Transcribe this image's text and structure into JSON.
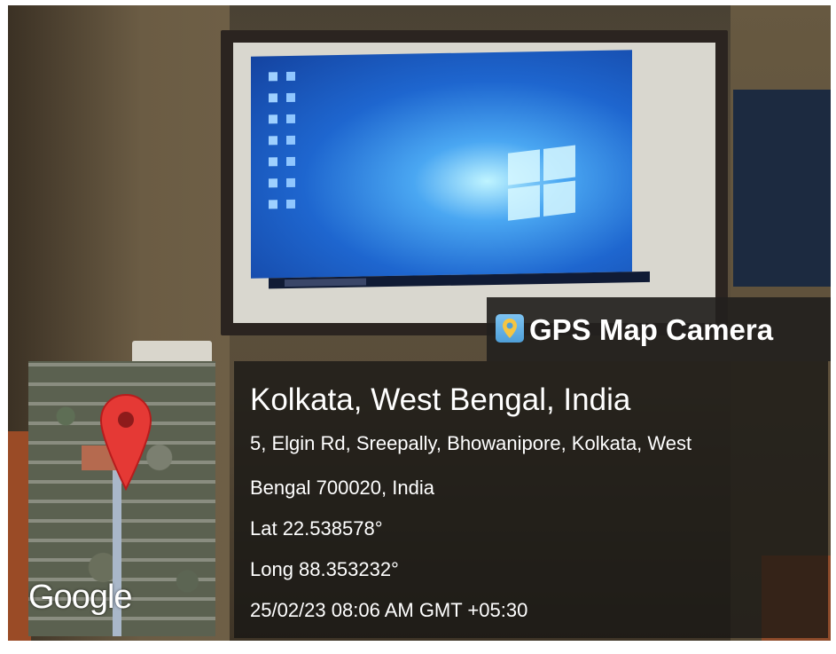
{
  "overlay": {
    "app_name": "GPS Map Camera",
    "app_icon": "gps-map-camera-icon",
    "location_title": "Kolkata, West Bengal, India",
    "address_line_1": "5, Elgin Rd, Sreepally, Bhowanipore, Kolkata, West",
    "address_line_2": "Bengal 700020, India",
    "latitude": "Lat 22.538578°",
    "longitude": "Long 88.353232°",
    "datetime": "25/02/23 08:06 AM GMT +05:30"
  },
  "map": {
    "attribution": "Google",
    "marker_icon": "map-pin-icon",
    "marker_color": "#e53935"
  },
  "scene": {
    "subject": "classroom projection screen showing Windows desktop"
  },
  "colors": {
    "overlay_bg": "#141312",
    "text": "#ffffff",
    "pin": "#e53935"
  }
}
